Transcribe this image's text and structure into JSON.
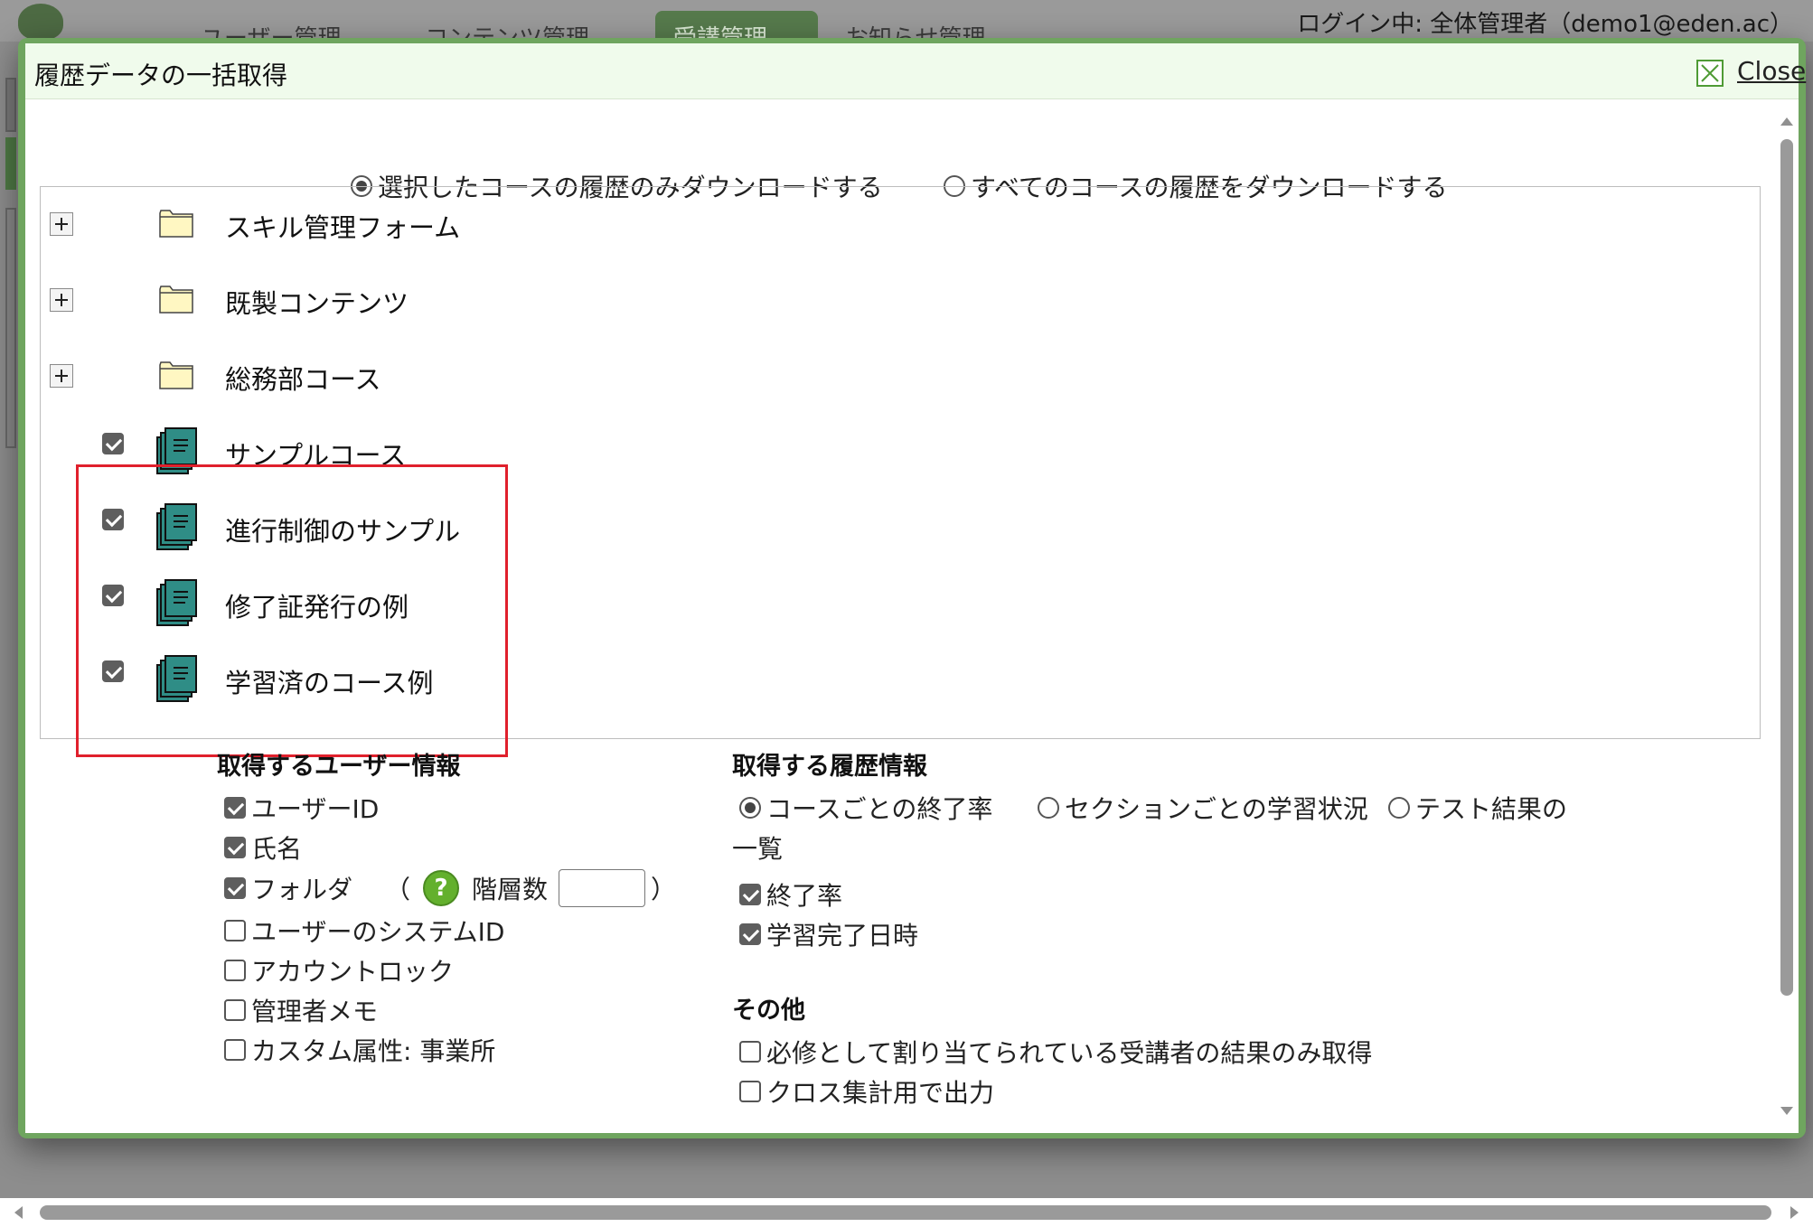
{
  "background": {
    "nav": [
      "ユーザー管理",
      "コンテンツ管理",
      "受講管理",
      "お知らせ管理"
    ],
    "login_status": "ログイン中: 全体管理者（demo1@eden.ac）"
  },
  "dialog": {
    "title": "履歴データの一括取得",
    "close_label": "Close"
  },
  "scope_options": [
    {
      "label": "選択したコースの履歴のみダウンロードする",
      "selected": true
    },
    {
      "label": "すべてのコースの履歴をダウンロードする",
      "selected": false
    }
  ],
  "tree": {
    "folders": [
      {
        "label": "スキル管理フォーム"
      },
      {
        "label": "既製コンテンツ"
      },
      {
        "label": "総務部コース"
      }
    ],
    "courses": [
      {
        "label": "サンプルコース",
        "checked": true
      },
      {
        "label": "進行制御のサンプル",
        "checked": true
      },
      {
        "label": "修了証発行の例",
        "checked": true
      },
      {
        "label": "学習済のコース例",
        "checked": true
      }
    ]
  },
  "user_info": {
    "heading": "取得するユーザー情報",
    "items": [
      {
        "label": "ユーザーID",
        "checked": true
      },
      {
        "label": "氏名",
        "checked": true
      },
      {
        "label": "フォルダ",
        "checked": true
      },
      {
        "label": "ユーザーのシステムID",
        "checked": false
      },
      {
        "label": "アカウントロック",
        "checked": false
      },
      {
        "label": "管理者メモ",
        "checked": false
      },
      {
        "label": "カスタム属性: 事業所",
        "checked": false
      }
    ],
    "folder_paren_open": "（",
    "folder_paren_close": "）",
    "depth_label": "階層数",
    "depth_value": "",
    "help_icon_text": "?"
  },
  "history_info": {
    "heading": "取得する履歴情報",
    "types": [
      {
        "label": "コースごとの終了率",
        "selected": true
      },
      {
        "label": "セクションごとの学習状況",
        "selected": false
      },
      {
        "label": "テスト結果の",
        "selected": false
      }
    ],
    "types_wrap": "一覧",
    "items": [
      {
        "label": "終了率",
        "checked": true
      },
      {
        "label": "学習完了日時",
        "checked": true
      }
    ]
  },
  "other": {
    "heading": "その他",
    "items": [
      {
        "label": "必修として割り当てられている受講者の結果のみ取得",
        "checked": false
      },
      {
        "label": "クロス集計用で出力",
        "checked": false
      }
    ]
  },
  "colors": {
    "dialog_border": "#6fa55f",
    "header_bg": "#f0fbec",
    "highlight": "#e0202c",
    "course_icon": "#2f8d86",
    "folder_fill": "#fff7c2",
    "help_icon": "#63b02d"
  }
}
